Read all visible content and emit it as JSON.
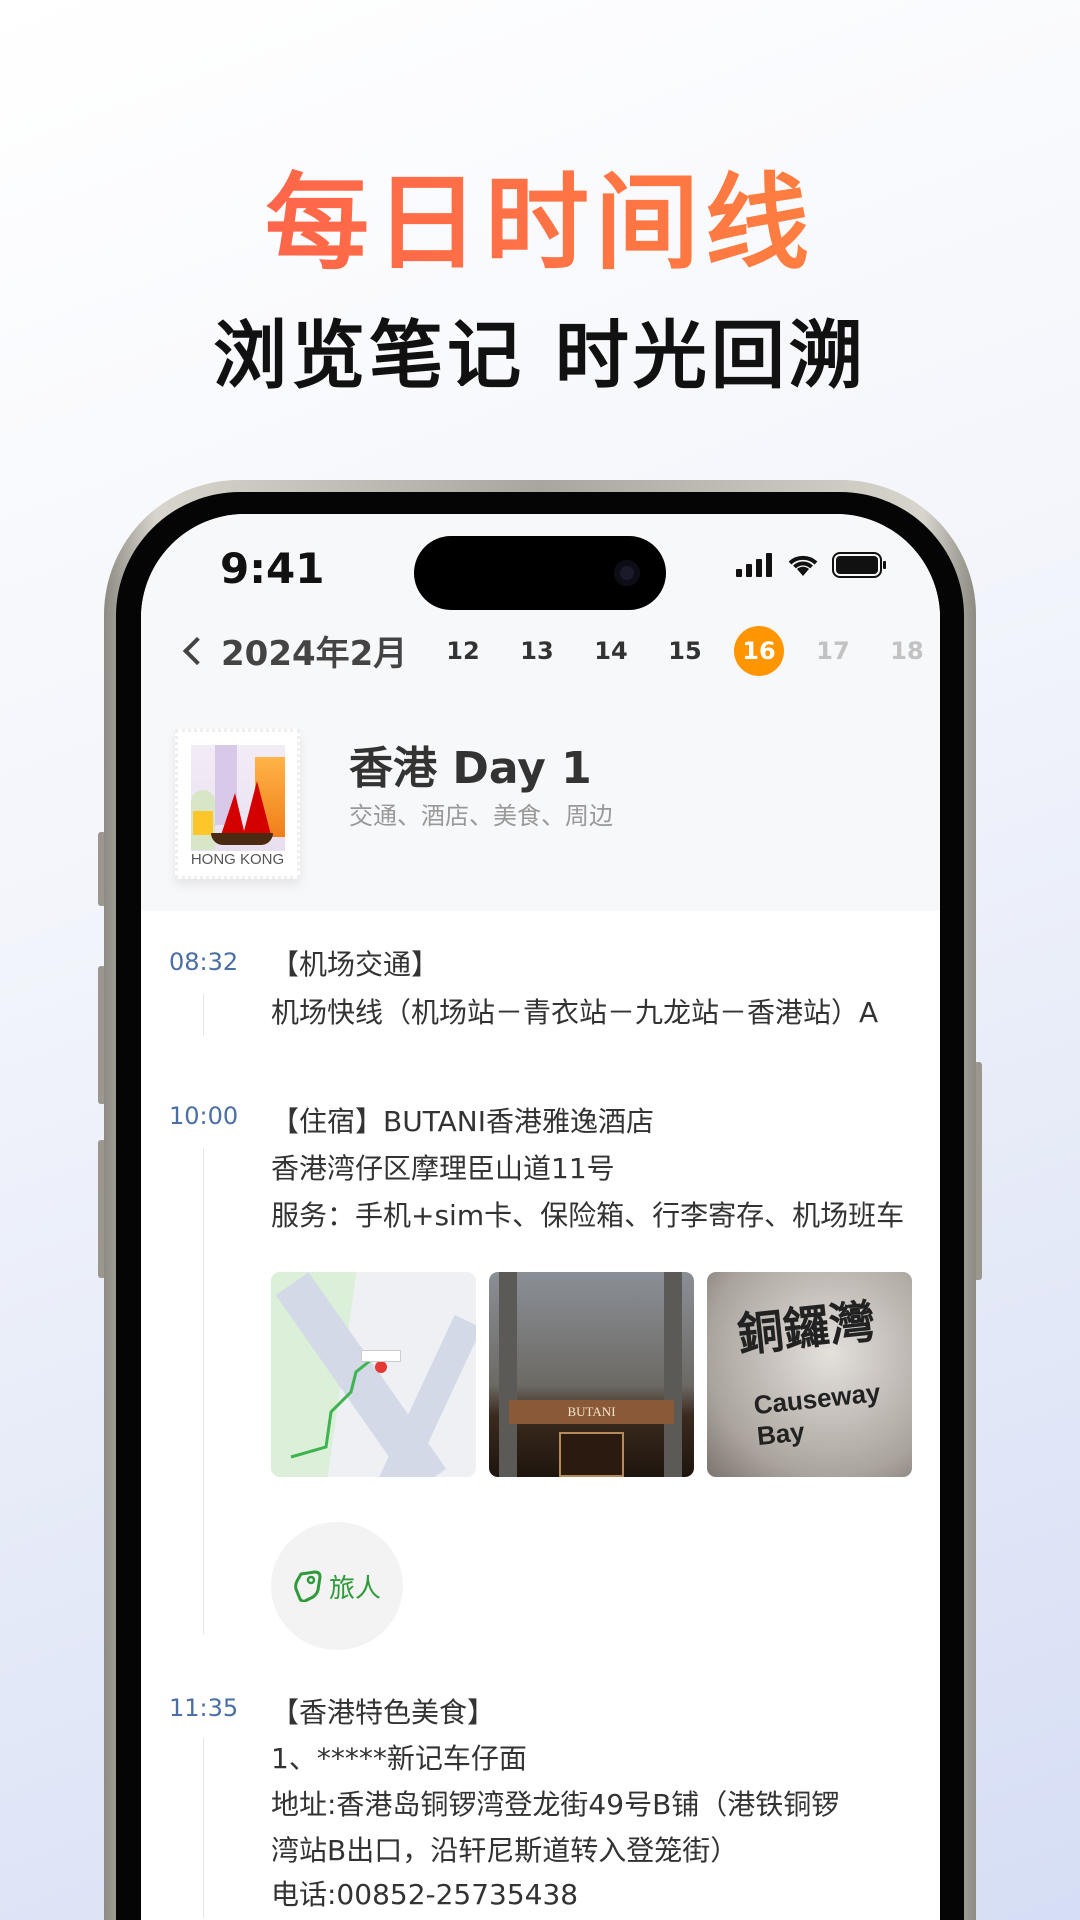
{
  "hero": {
    "title": "每日时间线",
    "subtitle": "浏览笔记  时光回溯"
  },
  "status_bar": {
    "time": "9:41"
  },
  "calendar": {
    "month": "2024年2月",
    "dates": [
      "12",
      "13",
      "14",
      "15",
      "16",
      "17",
      "18"
    ],
    "selected": "16",
    "accent": "#ff9500"
  },
  "day": {
    "stamp_label": "HONG KONG",
    "title": "香港 Day 1",
    "subtitle": "交通、酒店、美食、周边"
  },
  "entries": [
    {
      "time": "08:32",
      "lines": [
        "【机场交通】",
        "机场快线（机场站－青衣站－九龙站－香港站）A"
      ]
    },
    {
      "time": "10:00",
      "lines": [
        "【住宿】BUTANI香港雅逸酒店",
        "香港湾仔区摩理臣山道11号",
        "服务：手机+sim卡、保险箱、行李寄存、机场班车"
      ],
      "photos": [
        "map",
        "hotel-facade",
        "causeway-bay-sign"
      ],
      "photo_text": {
        "hotel": "BUTANI",
        "sign_cn": "銅鑼灣",
        "sign_en": "Causeway Bay"
      },
      "tag": "旅人"
    },
    {
      "time": "11:35",
      "lines": [
        "【香港特色美食】",
        "1、*****新记车仔面",
        "地址:香港岛铜锣湾登龙街49号B铺（港铁铜锣",
        "湾站B出口，沿轩尼斯道转入登笼街）",
        "电话:00852-25735438"
      ]
    }
  ],
  "colors": {
    "time": "#4a6fa5",
    "tag": "#2e9a3a"
  }
}
